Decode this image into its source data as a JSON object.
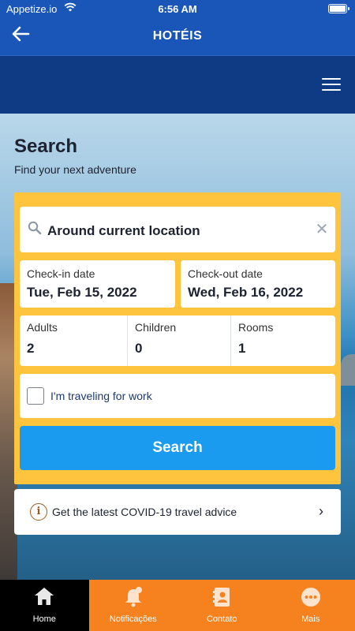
{
  "status_bar": {
    "carrier": "Appetize.io",
    "time": "6:56 AM"
  },
  "app_header": {
    "title": "HOTÉIS",
    "back_icon": "arrow-left-icon"
  },
  "site_nav": {
    "menu_icon": "hamburger-menu-icon"
  },
  "search": {
    "heading": "Search",
    "subheading": "Find your next adventure",
    "destination": "Around current location",
    "checkin_label": "Check-in date",
    "checkin_value": "Tue, Feb 15, 2022",
    "checkout_label": "Check-out date",
    "checkout_value": "Wed, Feb 16, 2022",
    "adults_label": "Adults",
    "adults_value": "2",
    "children_label": "Children",
    "children_value": "0",
    "rooms_label": "Rooms",
    "rooms_value": "1",
    "work_label": "I'm traveling for work",
    "work_checked": false,
    "button_label": "Search"
  },
  "covid": {
    "text": "Get the latest COVID-19 travel advice"
  },
  "tabs": [
    {
      "label": "Home",
      "icon": "home-icon",
      "active": true
    },
    {
      "label": "Notificações",
      "icon": "bell-icon",
      "active": false
    },
    {
      "label": "Contato",
      "icon": "contacts-icon",
      "active": false
    },
    {
      "label": "Mais",
      "icon": "more-icon",
      "active": false
    }
  ],
  "colors": {
    "header_blue": "#1a55b8",
    "nav_blue": "#0f3b85",
    "form_yellow": "#ffc43d",
    "search_button": "#1a9bf0",
    "tab_orange": "#f5821e"
  }
}
